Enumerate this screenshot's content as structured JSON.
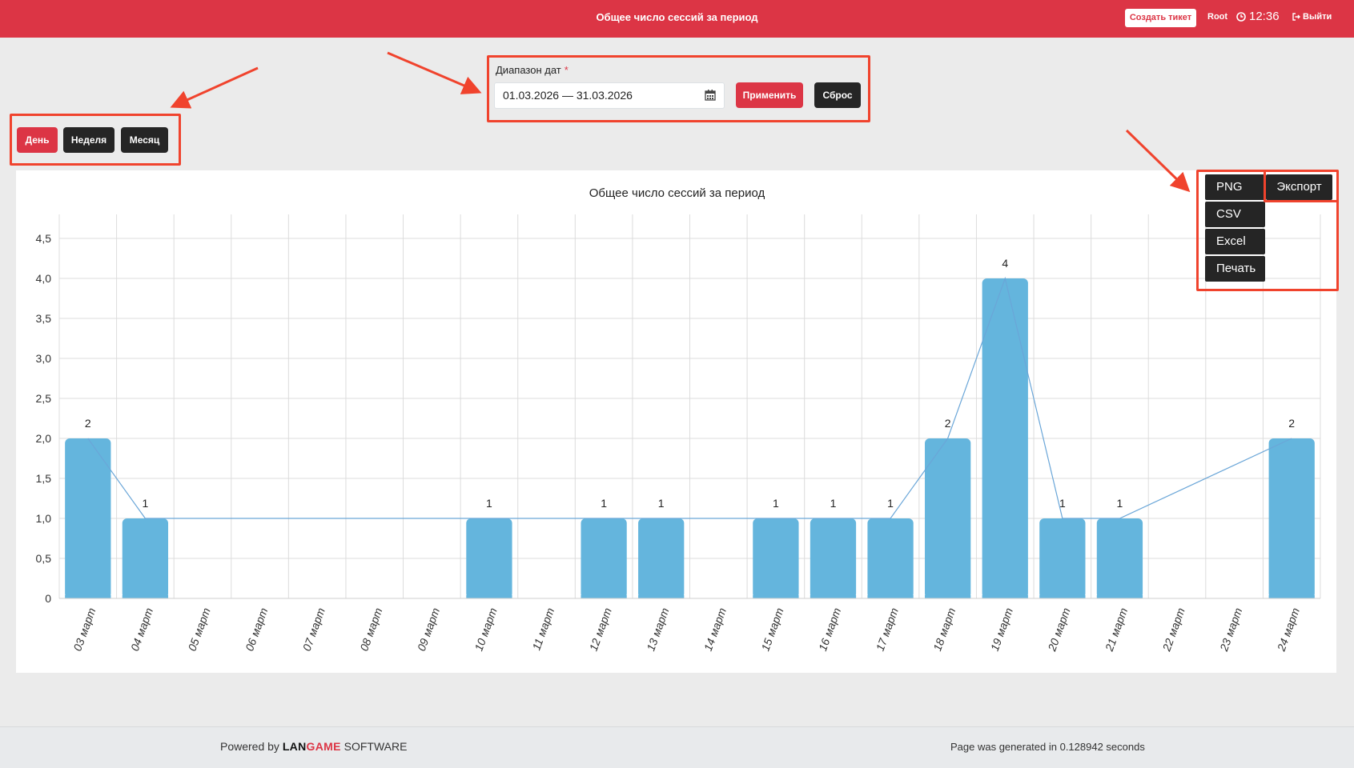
{
  "header": {
    "title": "Общее число сессий за период",
    "create_ticket": "Создать тикет",
    "user": "Root",
    "time": "12:36",
    "logout": "Выйти"
  },
  "period": {
    "day": "День",
    "week": "Неделя",
    "month": "Месяц"
  },
  "date_filter": {
    "label": "Диапазон дат",
    "required_mark": "*",
    "value": "01.03.2026 — 31.03.2026",
    "apply": "Применить",
    "reset": "Сброс"
  },
  "export": {
    "button": "Экспорт",
    "menu": [
      "PNG",
      "CSV",
      "Excel",
      "Печать"
    ]
  },
  "chart_data": {
    "type": "bar",
    "title": "Общее число сессий за период",
    "categories": [
      "03 март",
      "04 март",
      "05 март",
      "06 март",
      "07 март",
      "08 март",
      "09 март",
      "10 март",
      "11 март",
      "12 март",
      "13 март",
      "14 март",
      "15 март",
      "16 март",
      "17 март",
      "18 март",
      "19 март",
      "20 март",
      "21 март",
      "22 март",
      "23 март",
      "24 март"
    ],
    "values": [
      2,
      1,
      null,
      null,
      null,
      null,
      null,
      1,
      null,
      1,
      1,
      null,
      1,
      1,
      1,
      2,
      4,
      1,
      1,
      null,
      null,
      2
    ],
    "trend_line": true,
    "ylim": [
      0,
      4.5
    ],
    "yticks": [
      "0",
      "0,5",
      "1,0",
      "1,5",
      "2,0",
      "2,5",
      "3,0",
      "3,5",
      "4,0",
      "4,5"
    ],
    "grid": true,
    "colors": {
      "bar": "#64b5dd",
      "line": "#6aa6d8"
    }
  },
  "footer": {
    "powered_by": "Powered by",
    "brand_lan": "LAN",
    "brand_game": "GAME",
    "software": "SOFTWARE",
    "generated": "Page was generated in 0.128942 seconds"
  }
}
